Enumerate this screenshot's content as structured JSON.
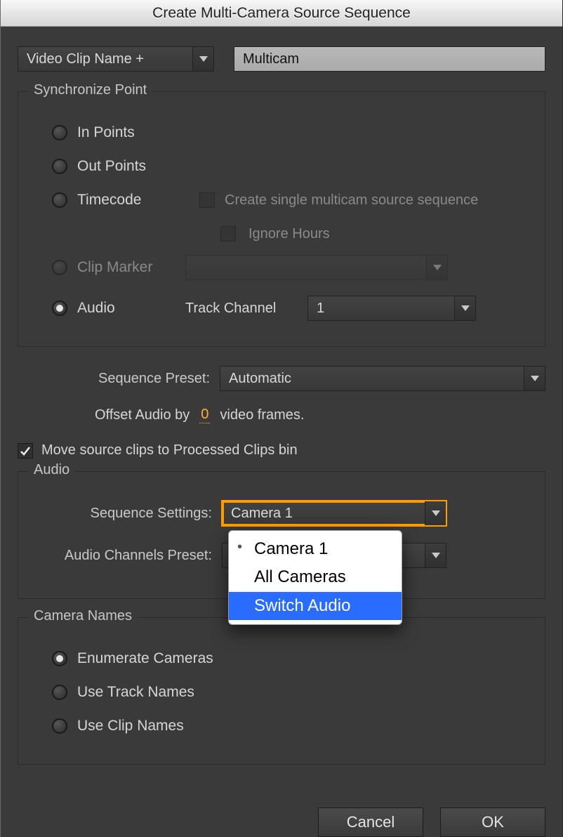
{
  "title": "Create Multi-Camera Source Sequence",
  "top": {
    "name_mode": "Video Clip Name +",
    "name_value": "Multicam"
  },
  "sync": {
    "legend": "Synchronize Point",
    "in_points": "In Points",
    "out_points": "Out Points",
    "timecode": "Timecode",
    "timecode_single": "Create single multicam source sequence",
    "timecode_ignore": "Ignore Hours",
    "clip_marker": "Clip Marker",
    "clip_marker_value": "",
    "audio": "Audio",
    "track_channel_label": "Track Channel",
    "track_channel_value": "1"
  },
  "sequence_preset_label": "Sequence Preset:",
  "sequence_preset_value": "Automatic",
  "offset_audio_prefix": "Offset Audio by",
  "offset_audio_value": "0",
  "offset_audio_suffix": "video frames.",
  "move_processed": "Move source clips to Processed Clips bin",
  "audio_group": {
    "legend": "Audio",
    "seq_settings_label": "Sequence Settings:",
    "seq_settings_value": "Camera 1",
    "channels_preset_label": "Audio Channels Preset:",
    "channels_preset_value": "",
    "popup_options": [
      "Camera 1",
      "All Cameras",
      "Switch Audio"
    ],
    "popup_selected_index": 0,
    "popup_highlight_index": 2
  },
  "camera_names": {
    "legend": "Camera Names",
    "enumerate": "Enumerate Cameras",
    "use_track": "Use Track Names",
    "use_clip": "Use Clip Names"
  },
  "buttons": {
    "cancel": "Cancel",
    "ok": "OK"
  }
}
